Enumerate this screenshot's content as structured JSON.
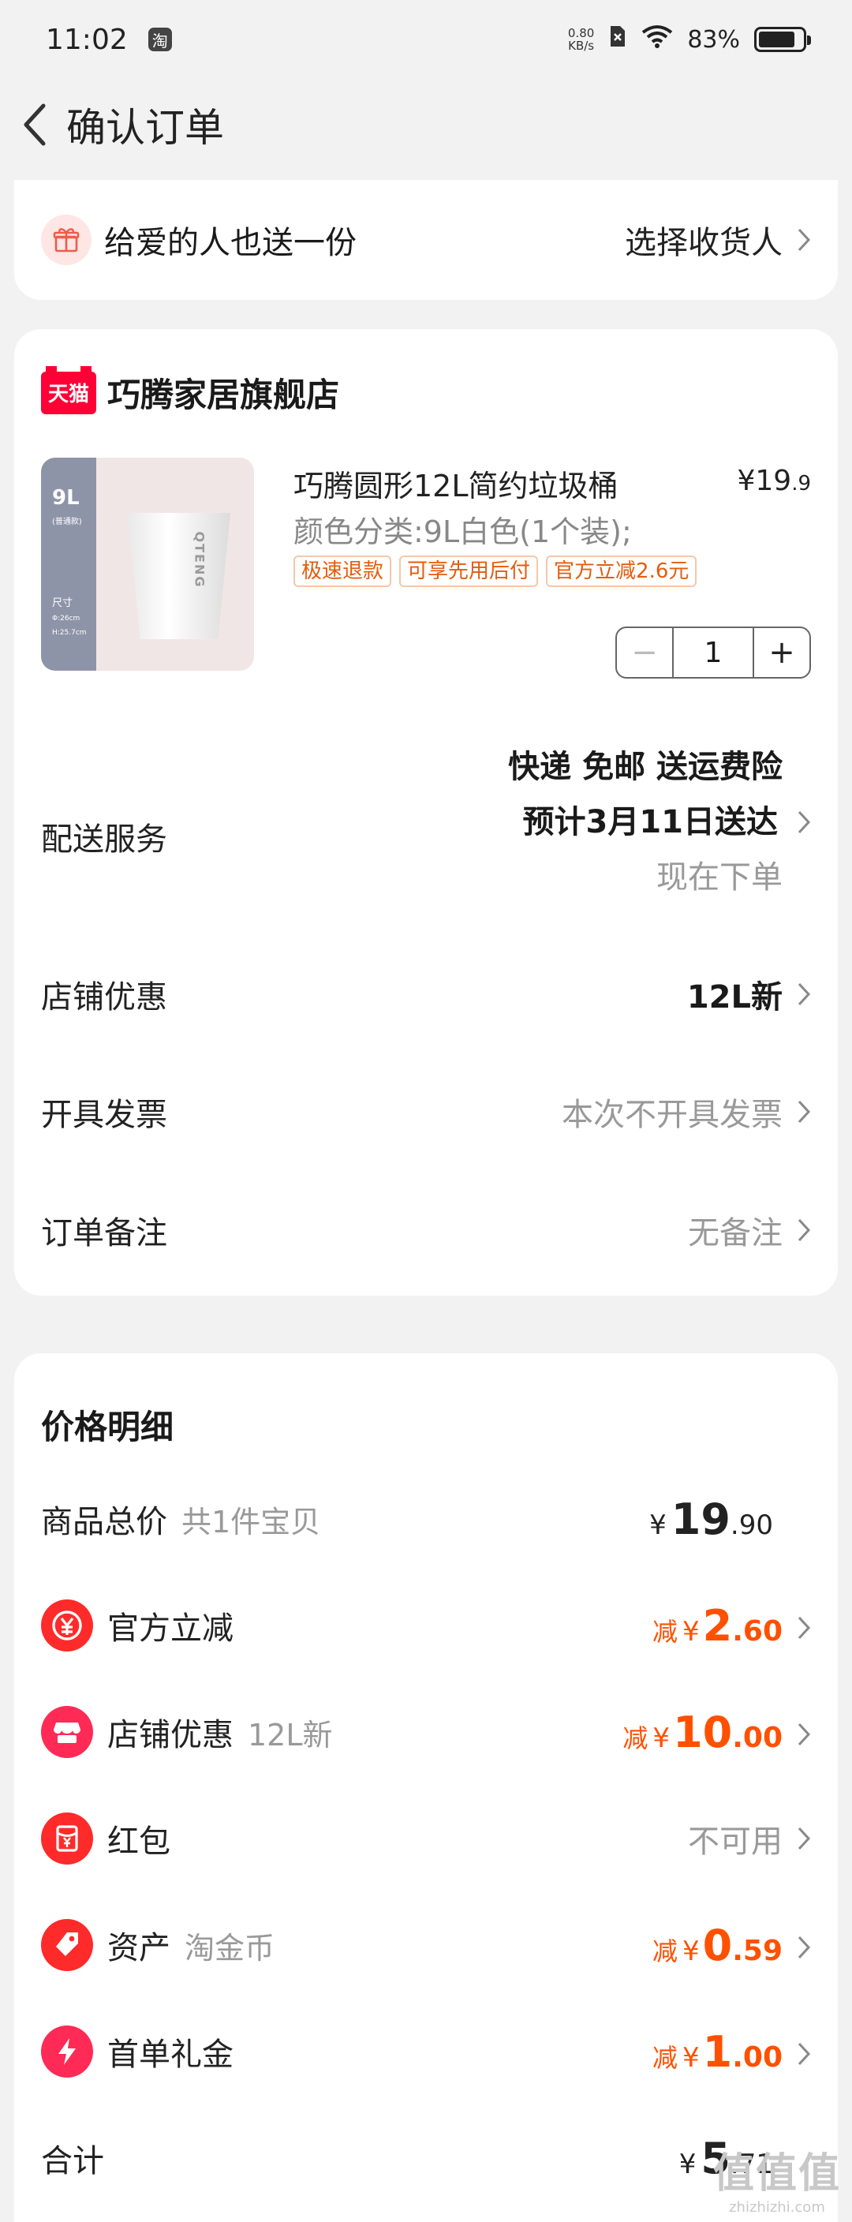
{
  "status_bar": {
    "time": "11:02",
    "app_icon": "淘",
    "net_speed_value": "0.80",
    "net_speed_unit": "KB/s",
    "battery": "83%",
    "battery_level": 0.83
  },
  "nav": {
    "title": "确认订单"
  },
  "gift": {
    "label": "给爱的人也送一份",
    "action": "选择收货人"
  },
  "store": {
    "logo": "天猫",
    "name": "巧腾家居旗舰店"
  },
  "product": {
    "thumb_size": "9L",
    "thumb_sub": "(普通款)",
    "thumb_dim_label": "尺寸",
    "thumb_dim1": "Φ:26cm",
    "thumb_dim2": "H:25.7cm",
    "thumb_brand": "QTENG",
    "title": "巧腾圆形12L简约垃圾桶",
    "price_yen": "¥",
    "price_int": "19",
    "price_dec": ".9",
    "spec": "颜色分类:9L白色(1个装);",
    "tags": [
      "极速退款",
      "可享先用后付",
      "官方立减2.6元"
    ],
    "quantity": "1",
    "minus": "−",
    "plus": "+"
  },
  "delivery": {
    "label": "配送服务",
    "line1": "快递 免邮 送运费险",
    "line2": "预计3月11日送达",
    "line3": "现在下单"
  },
  "store_discount": {
    "label": "店铺优惠",
    "value": "12L新"
  },
  "invoice": {
    "label": "开具发票",
    "value": "本次不开具发票"
  },
  "note": {
    "label": "订单备注",
    "value": "无备注"
  },
  "price_detail": {
    "title": "价格明细",
    "goods": {
      "label": "商品总价",
      "sub": "共1件宝贝",
      "yen": "¥",
      "int": "19",
      "dec": ".90"
    },
    "official": {
      "label": "官方立减",
      "jian": "减",
      "yen": "¥",
      "int": "2",
      "dec": ".60"
    },
    "shop": {
      "label": "店铺优惠",
      "sub": "12L新",
      "jian": "减",
      "yen": "¥",
      "int": "10",
      "dec": ".00"
    },
    "redpacket": {
      "label": "红包",
      "value": "不可用"
    },
    "assets": {
      "label": "资产",
      "sub": "淘金币",
      "jian": "减",
      "yen": "¥",
      "int": "0",
      "dec": ".59"
    },
    "first_order": {
      "label": "首单礼金",
      "jian": "减",
      "yen": "¥",
      "int": "1",
      "dec": ".00"
    },
    "total": {
      "label": "合计",
      "yen": "¥",
      "int": "5",
      "dec": ".71"
    }
  },
  "watermark": {
    "big": "值值值",
    "small": "zhizhizhi.com"
  },
  "colors": {
    "accent": "#ff5000",
    "tmall": "#ff0036",
    "icon_red": "#ff2a2a",
    "tag_text": "#e55c0c"
  }
}
